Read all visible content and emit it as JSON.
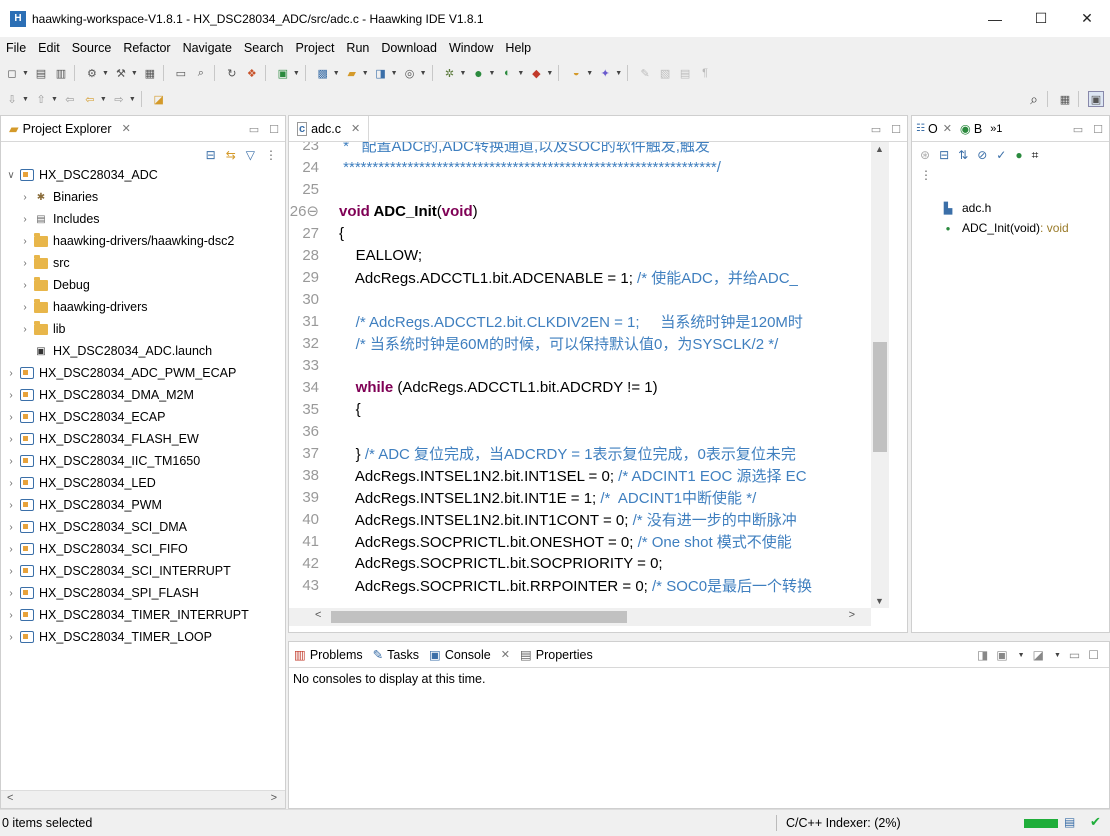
{
  "window": {
    "title": "haawking-workspace-V1.8.1 - HX_DSC28034_ADC/src/adc.c - Haawking IDE V1.8.1",
    "minimize": "—",
    "maximize": "☐",
    "close": "✕"
  },
  "menu": [
    "File",
    "Edit",
    "Source",
    "Refactor",
    "Navigate",
    "Search",
    "Project",
    "Run",
    "Download",
    "Window",
    "Help"
  ],
  "explorer": {
    "tab_label": "Project Explorer",
    "tree": [
      {
        "label": "HX_DSC28034_ADC",
        "level": 0,
        "expanded": true,
        "icon": "project-icon"
      },
      {
        "label": "Binaries",
        "level": 1,
        "icon": "binaries-icon"
      },
      {
        "label": "Includes",
        "level": 1,
        "icon": "includes-icon"
      },
      {
        "label": "haawking-drivers/haawking-dsc2",
        "level": 1,
        "icon": "linked-folder-icon"
      },
      {
        "label": "src",
        "level": 1,
        "icon": "source-folder-icon"
      },
      {
        "label": "Debug",
        "level": 1,
        "icon": "folder-icon"
      },
      {
        "label": "haawking-drivers",
        "level": 1,
        "icon": "folder-icon"
      },
      {
        "label": "lib",
        "level": 1,
        "icon": "folder-icon"
      },
      {
        "label": "HX_DSC28034_ADC.launch",
        "level": 1,
        "icon": "launch-file-icon",
        "leaf": true
      },
      {
        "label": "HX_DSC28034_ADC_PWM_ECAP",
        "level": 0,
        "icon": "project-icon"
      },
      {
        "label": "HX_DSC28034_DMA_M2M",
        "level": 0,
        "icon": "project-icon"
      },
      {
        "label": "HX_DSC28034_ECAP",
        "level": 0,
        "icon": "project-icon"
      },
      {
        "label": "HX_DSC28034_FLASH_EW",
        "level": 0,
        "icon": "project-icon"
      },
      {
        "label": "HX_DSC28034_IIC_TM1650",
        "level": 0,
        "icon": "project-icon"
      },
      {
        "label": "HX_DSC28034_LED",
        "level": 0,
        "icon": "project-icon"
      },
      {
        "label": "HX_DSC28034_PWM",
        "level": 0,
        "icon": "project-icon"
      },
      {
        "label": "HX_DSC28034_SCI_DMA",
        "level": 0,
        "icon": "project-icon"
      },
      {
        "label": "HX_DSC28034_SCI_FIFO",
        "level": 0,
        "icon": "project-icon"
      },
      {
        "label": "HX_DSC28034_SCI_INTERRUPT",
        "level": 0,
        "icon": "project-icon"
      },
      {
        "label": "HX_DSC28034_SPI_FLASH",
        "level": 0,
        "icon": "project-icon"
      },
      {
        "label": "HX_DSC28034_TIMER_INTERRUPT",
        "level": 0,
        "icon": "project-icon"
      },
      {
        "label": "HX_DSC28034_TIMER_LOOP",
        "level": 0,
        "icon": "project-icon"
      }
    ]
  },
  "editor": {
    "tab_label": "adc.c",
    "lines": [
      {
        "n": "23",
        "text": " *   配置ADC的,ADC转换通道,以及SOC的软件触发,触发",
        "style": "cm"
      },
      {
        "n": "24",
        "text": " ****************************************************************/",
        "style": "cm"
      },
      {
        "n": "25",
        "text": "",
        "style": ""
      },
      {
        "n": "26⊖",
        "text": "void ADC_Init(void)",
        "style": "func"
      },
      {
        "n": "27",
        "text": "{",
        "style": ""
      },
      {
        "n": "28",
        "text": "    EALLOW;",
        "style": ""
      },
      {
        "n": "29",
        "text": "    AdcRegs.ADCCTL1.bit.ADCENABLE = 1; /* 使能ADC，并给ADC_",
        "style": "mixed",
        "code": "    AdcRegs.ADCCTL1.bit.ADCENABLE = 1; ",
        "comment": "/* 使能ADC，并给ADC_"
      },
      {
        "n": "30",
        "text": "",
        "style": ""
      },
      {
        "n": "31",
        "text": "    /* AdcRegs.ADCCTL2.bit.CLKDIV2EN = 1;     当系统时钟是120M时",
        "style": "cm"
      },
      {
        "n": "32",
        "text": "    /* 当系统时钟是60M的时候，可以保持默认值0，为SYSCLK/2 */",
        "style": "cm"
      },
      {
        "n": "33",
        "text": "",
        "style": ""
      },
      {
        "n": "34",
        "text": "    while (AdcRegs.ADCCTL1.bit.ADCRDY != 1)",
        "style": "while",
        "kw": "while",
        "rest": " (AdcRegs.ADCCTL1.bit.ADCRDY != 1)"
      },
      {
        "n": "35",
        "text": "    {",
        "style": ""
      },
      {
        "n": "36",
        "text": "",
        "style": ""
      },
      {
        "n": "37",
        "text": "    } /* ADC 复位完成，当ADCRDY = 1表示复位完成，0表示复位未完",
        "style": "mixed",
        "code": "    } ",
        "comment": "/* ADC 复位完成，当ADCRDY = 1表示复位完成，0表示复位未完"
      },
      {
        "n": "38",
        "text": "    AdcRegs.INTSEL1N2.bit.INT1SEL = 0; /* ADCINT1 EOC 源选择 EC",
        "style": "mixed",
        "code": "    AdcRegs.INTSEL1N2.bit.INT1SEL = 0; ",
        "comment": "/* ADCINT1 EOC 源选择 EC"
      },
      {
        "n": "39",
        "text": "    AdcRegs.INTSEL1N2.bit.INT1E = 1; /*  ADCINT1中断使能 */",
        "style": "mixed",
        "code": "    AdcRegs.INTSEL1N2.bit.INT1E = 1; ",
        "comment": "/*  ADCINT1中断使能 */"
      },
      {
        "n": "40",
        "text": "    AdcRegs.INTSEL1N2.bit.INT1CONT = 0; /* 没有进一步的中断脉冲",
        "style": "mixed",
        "code": "    AdcRegs.INTSEL1N2.bit.INT1CONT = 0; ",
        "comment": "/* 没有进一步的中断脉冲"
      },
      {
        "n": "41",
        "text": "    AdcRegs.SOCPRICTL.bit.ONESHOT = 0; /* One shot 模式不使能",
        "style": "mixed",
        "code": "    AdcRegs.SOCPRICTL.bit.ONESHOT = 0; ",
        "comment": "/* One shot 模式不使能"
      },
      {
        "n": "42",
        "text": "    AdcRegs.SOCPRICTL.bit.SOCPRIORITY = 0;",
        "style": ""
      },
      {
        "n": "43",
        "text": "    AdcRegs.SOCPRICTL.bit.RRPOINTER = 0; /* SOC0是最后一个转换",
        "style": "mixed",
        "code": "    AdcRegs.SOCPRICTL.bit.RRPOINTER = 0; ",
        "comment": "/* SOC0是最后一个转换"
      }
    ]
  },
  "outline": {
    "tab_o": "O",
    "tab_b": "B",
    "more": "»1",
    "items": [
      {
        "label": "adc.h",
        "icon": "include-icon"
      },
      {
        "label": "ADC_Init(void)",
        "suffix": " : void",
        "icon": "function-icon"
      }
    ]
  },
  "bottom": {
    "tabs": [
      "Problems",
      "Tasks",
      "Console",
      "Properties"
    ],
    "message": "No consoles to display at this time."
  },
  "status": {
    "selection": "0 items selected",
    "indexer": "C/C++ Indexer: (2%)"
  },
  "colors": {
    "keyword": "#7f0055",
    "comment": "#3f7fbf",
    "progress": "#1fae3a"
  }
}
